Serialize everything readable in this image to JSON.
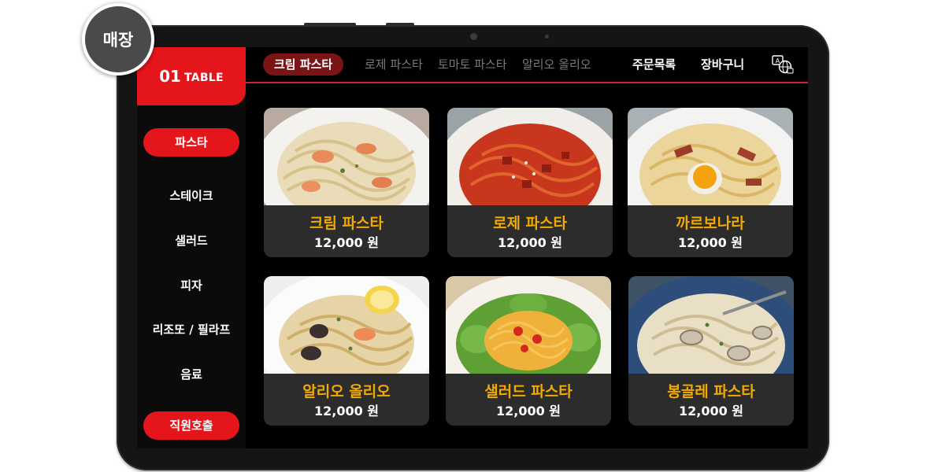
{
  "badge": "매장",
  "table": {
    "number": "01",
    "label": "TABLE"
  },
  "categories": [
    {
      "label": "파스타",
      "active": true
    },
    {
      "label": "스테이크"
    },
    {
      "label": "샐러드"
    },
    {
      "label": "피자"
    },
    {
      "label": "리조또 / 필라프"
    },
    {
      "label": "음료"
    }
  ],
  "call_staff": "직원호출",
  "tabs": [
    "크림 파스타",
    "로제 파스타",
    "토마토 파스타",
    "알리오 올리오"
  ],
  "nav": {
    "orders": "주문목록",
    "cart": "장바구니"
  },
  "icons": {
    "language": "language-icon"
  },
  "colors": {
    "accent": "#e4161c",
    "active_tab": "#7a1416",
    "name": "#f2a900",
    "card": "#2c2c2c"
  },
  "menu": [
    {
      "name": "크림 파스타",
      "price": "12,000 원"
    },
    {
      "name": "로제 파스타",
      "price": "12,000 원"
    },
    {
      "name": "까르보나라",
      "price": "12,000 원"
    },
    {
      "name": "알리오 올리오",
      "price": "12,000 원"
    },
    {
      "name": "샐러드 파스타",
      "price": "12,000 원"
    },
    {
      "name": "봉골레 파스타",
      "price": "12,000 원"
    }
  ]
}
